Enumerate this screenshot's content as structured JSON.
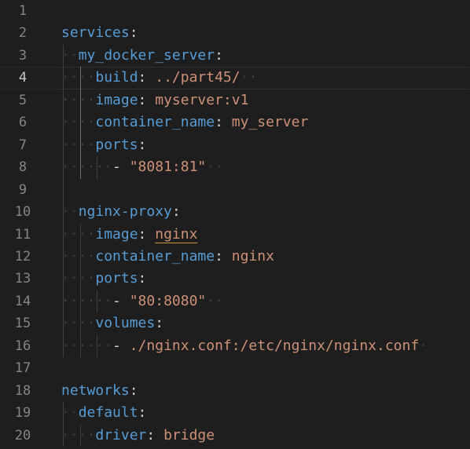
{
  "editor": {
    "current_line": 4,
    "lines": [
      {
        "no": "1",
        "tokens": []
      },
      {
        "no": "2",
        "tokens": [
          {
            "k": "key",
            "t": "services"
          },
          {
            "k": "punct",
            "t": ":"
          }
        ]
      },
      {
        "no": "3",
        "tokens": [
          {
            "k": "ws",
            "t": "··"
          },
          {
            "k": "key",
            "t": "my_docker_server"
          },
          {
            "k": "punct",
            "t": ":"
          }
        ]
      },
      {
        "no": "4",
        "tokens": [
          {
            "k": "ws",
            "t": "····"
          },
          {
            "k": "key",
            "t": "build"
          },
          {
            "k": "punct",
            "t": ": "
          },
          {
            "k": "val",
            "t": "../part45/"
          },
          {
            "k": "ws",
            "t": "··"
          }
        ]
      },
      {
        "no": "5",
        "tokens": [
          {
            "k": "ws",
            "t": "····"
          },
          {
            "k": "key",
            "t": "image"
          },
          {
            "k": "punct",
            "t": ": "
          },
          {
            "k": "val",
            "t": "myserver:v1"
          }
        ]
      },
      {
        "no": "6",
        "tokens": [
          {
            "k": "ws",
            "t": "····"
          },
          {
            "k": "key",
            "t": "container_name"
          },
          {
            "k": "punct",
            "t": ": "
          },
          {
            "k": "val",
            "t": "my_server"
          }
        ]
      },
      {
        "no": "7",
        "tokens": [
          {
            "k": "ws",
            "t": "····"
          },
          {
            "k": "key",
            "t": "ports"
          },
          {
            "k": "punct",
            "t": ":"
          }
        ]
      },
      {
        "no": "8",
        "tokens": [
          {
            "k": "ws",
            "t": "······"
          },
          {
            "k": "punct",
            "t": "- "
          },
          {
            "k": "val",
            "t": "\"8081:81\""
          },
          {
            "k": "ws",
            "t": "··"
          }
        ]
      },
      {
        "no": "9",
        "tokens": []
      },
      {
        "no": "10",
        "tokens": [
          {
            "k": "ws",
            "t": "··"
          },
          {
            "k": "key",
            "t": "nginx-proxy"
          },
          {
            "k": "punct",
            "t": ":"
          }
        ]
      },
      {
        "no": "11",
        "tokens": [
          {
            "k": "ws",
            "t": "····"
          },
          {
            "k": "key",
            "t": "image"
          },
          {
            "k": "punct",
            "t": ": "
          },
          {
            "k": "val squiggle",
            "t": "nginx"
          }
        ]
      },
      {
        "no": "12",
        "tokens": [
          {
            "k": "ws",
            "t": "····"
          },
          {
            "k": "key",
            "t": "container_name"
          },
          {
            "k": "punct",
            "t": ": "
          },
          {
            "k": "val",
            "t": "nginx"
          }
        ]
      },
      {
        "no": "13",
        "tokens": [
          {
            "k": "ws",
            "t": "····"
          },
          {
            "k": "key",
            "t": "ports"
          },
          {
            "k": "punct",
            "t": ":"
          }
        ]
      },
      {
        "no": "14",
        "tokens": [
          {
            "k": "ws",
            "t": "······"
          },
          {
            "k": "punct",
            "t": "- "
          },
          {
            "k": "val",
            "t": "\"80:8080\""
          },
          {
            "k": "ws",
            "t": "··"
          }
        ]
      },
      {
        "no": "15",
        "tokens": [
          {
            "k": "ws",
            "t": "····"
          },
          {
            "k": "key",
            "t": "volumes"
          },
          {
            "k": "punct",
            "t": ":"
          }
        ]
      },
      {
        "no": "16",
        "tokens": [
          {
            "k": "ws",
            "t": "······"
          },
          {
            "k": "punct",
            "t": "- "
          },
          {
            "k": "val",
            "t": "./nginx.conf:/etc/nginx/nginx.conf"
          },
          {
            "k": "ws",
            "t": "·"
          }
        ]
      },
      {
        "no": "17",
        "tokens": []
      },
      {
        "no": "18",
        "tokens": [
          {
            "k": "key",
            "t": "networks"
          },
          {
            "k": "punct",
            "t": ":"
          }
        ]
      },
      {
        "no": "19",
        "tokens": [
          {
            "k": "ws",
            "t": "··"
          },
          {
            "k": "key",
            "t": "default"
          },
          {
            "k": "punct",
            "t": ":"
          }
        ]
      },
      {
        "no": "20",
        "tokens": [
          {
            "k": "ws",
            "t": "····"
          },
          {
            "k": "key",
            "t": "driver"
          },
          {
            "k": "punct",
            "t": ": "
          },
          {
            "k": "val",
            "t": "bridge"
          }
        ]
      }
    ]
  }
}
